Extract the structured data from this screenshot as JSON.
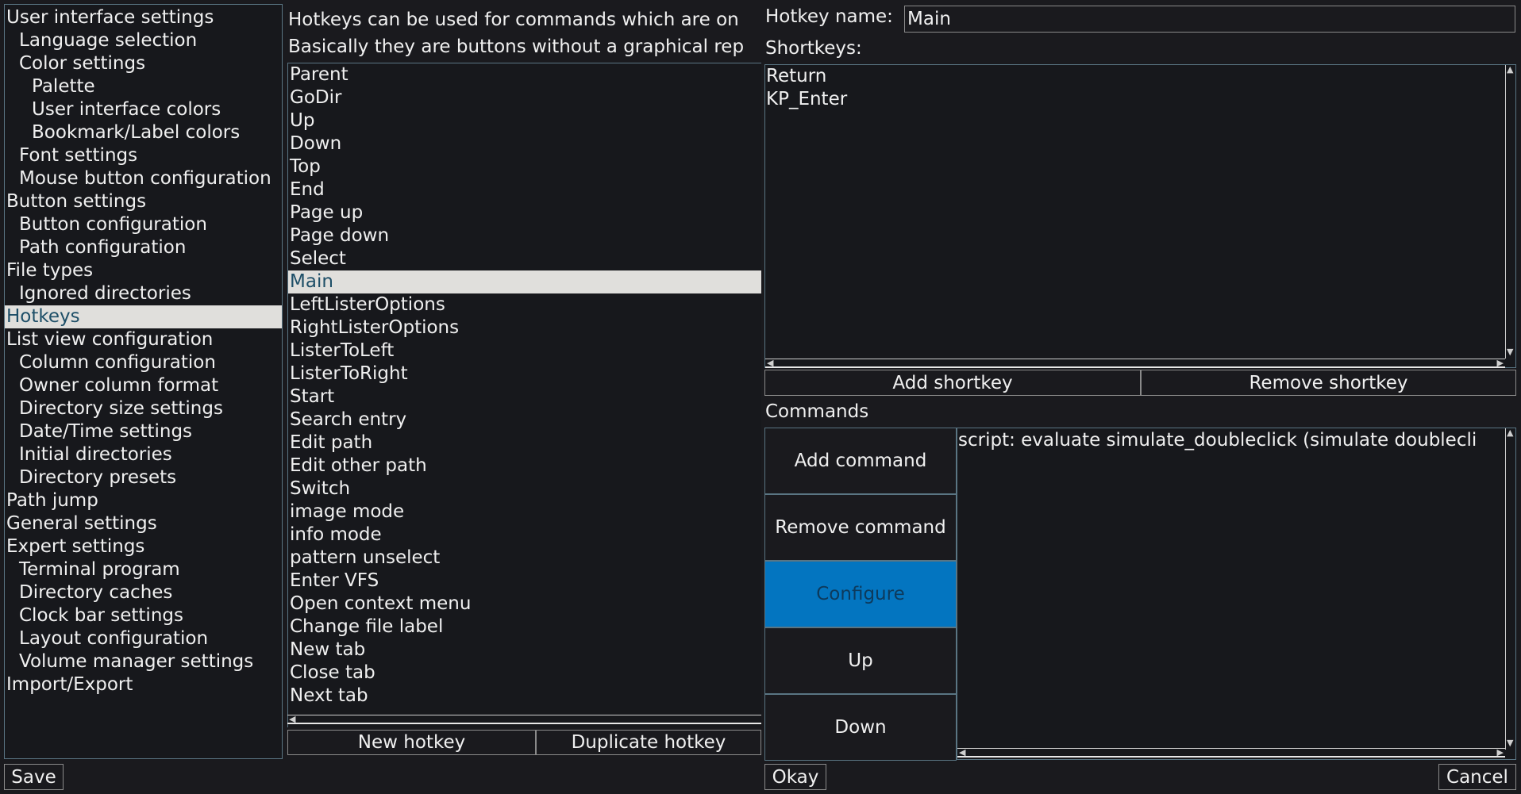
{
  "sidebar": {
    "items": [
      {
        "label": "User interface settings",
        "indent": 0
      },
      {
        "label": "Language selection",
        "indent": 1
      },
      {
        "label": "Color settings",
        "indent": 1
      },
      {
        "label": "Palette",
        "indent": 2
      },
      {
        "label": "User interface colors",
        "indent": 2
      },
      {
        "label": "Bookmark/Label colors",
        "indent": 2
      },
      {
        "label": "Font settings",
        "indent": 1
      },
      {
        "label": "Mouse button configuration",
        "indent": 1
      },
      {
        "label": "Button settings",
        "indent": 0
      },
      {
        "label": "Button configuration",
        "indent": 1
      },
      {
        "label": "Path configuration",
        "indent": 1
      },
      {
        "label": "File types",
        "indent": 0
      },
      {
        "label": "Ignored directories",
        "indent": 1
      },
      {
        "label": "Hotkeys",
        "indent": 0,
        "selected": true
      },
      {
        "label": "List view configuration",
        "indent": 0
      },
      {
        "label": "Column configuration",
        "indent": 1
      },
      {
        "label": "Owner column format",
        "indent": 1
      },
      {
        "label": "Directory size settings",
        "indent": 1
      },
      {
        "label": "Date/Time settings",
        "indent": 1
      },
      {
        "label": "Initial directories",
        "indent": 1
      },
      {
        "label": "Directory presets",
        "indent": 1
      },
      {
        "label": "Path jump",
        "indent": 0
      },
      {
        "label": "General settings",
        "indent": 0
      },
      {
        "label": "Expert settings",
        "indent": 0
      },
      {
        "label": "Terminal program",
        "indent": 1
      },
      {
        "label": "Directory caches",
        "indent": 1
      },
      {
        "label": "Clock bar settings",
        "indent": 1
      },
      {
        "label": "Layout configuration",
        "indent": 1
      },
      {
        "label": "Volume manager settings",
        "indent": 1
      },
      {
        "label": "Import/Export",
        "indent": 0
      }
    ]
  },
  "hotkeys": {
    "description_line1": "Hotkeys can be used for commands which are on",
    "description_line2": "Basically they are buttons without a graphical rep",
    "items": [
      {
        "label": "Parent"
      },
      {
        "label": "GoDir"
      },
      {
        "label": "Up"
      },
      {
        "label": "Down"
      },
      {
        "label": "Top"
      },
      {
        "label": "End"
      },
      {
        "label": "Page up"
      },
      {
        "label": "Page down"
      },
      {
        "label": "Select"
      },
      {
        "label": "Main",
        "selected": true
      },
      {
        "label": "LeftListerOptions"
      },
      {
        "label": "RightListerOptions"
      },
      {
        "label": "ListerToLeft"
      },
      {
        "label": "ListerToRight"
      },
      {
        "label": "Start"
      },
      {
        "label": "Search entry"
      },
      {
        "label": "Edit path"
      },
      {
        "label": "Edit other path"
      },
      {
        "label": "Switch"
      },
      {
        "label": "image mode"
      },
      {
        "label": "info mode"
      },
      {
        "label": "pattern unselect"
      },
      {
        "label": "Enter VFS"
      },
      {
        "label": "Open context menu"
      },
      {
        "label": "Change file label"
      },
      {
        "label": "New tab"
      },
      {
        "label": "Close tab"
      },
      {
        "label": "Next tab"
      }
    ],
    "new_label": "New hotkey",
    "duplicate_label": "Duplicate hotkey"
  },
  "details": {
    "name_label": "Hotkey name:",
    "name_value": "Main",
    "shortkeys_label": "Shortkeys:",
    "shortkeys": [
      "Return",
      "KP_Enter"
    ],
    "add_shortkey_label": "Add shortkey",
    "remove_shortkey_label": "Remove shortkey",
    "commands_label": "Commands",
    "command_buttons": [
      {
        "label": "Add command"
      },
      {
        "label": "Remove command"
      },
      {
        "label": "Configure",
        "active": true
      },
      {
        "label": "Up"
      },
      {
        "label": "Down"
      }
    ],
    "commands": [
      "script: evaluate simulate_doubleclick (simulate doublecli"
    ]
  },
  "footer": {
    "save_label": "Save",
    "okay_label": "Okay",
    "cancel_label": "Cancel"
  },
  "colors": {
    "background": "#1a1a1e",
    "selection_bg": "#e0dfdc",
    "selection_fg": "#1e4f68",
    "active_button": "#0375c0",
    "border": "#5a7583"
  }
}
